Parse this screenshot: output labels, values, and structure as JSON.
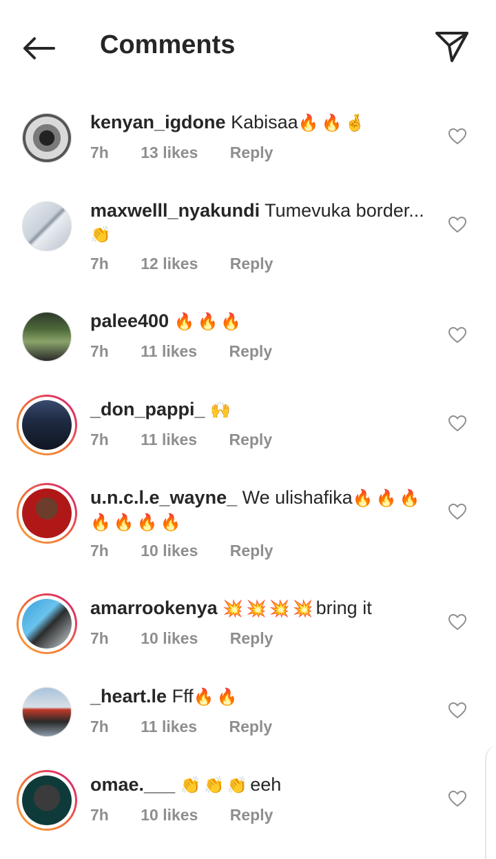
{
  "header": {
    "title": "Comments",
    "back_icon": "arrow-left-icon",
    "share_icon": "paper-plane-icon"
  },
  "colors": {
    "text": "#262626",
    "meta": "#8e8e8e",
    "story_ring_start": "#f9a33b",
    "story_ring_end": "#c8287a"
  },
  "comments": [
    {
      "username": "kenyan_igdone",
      "text": "Kabisaa",
      "emoji": "🔥🔥🤞",
      "time": "7h",
      "likes": "13 likes",
      "reply": "Reply",
      "avatar_ring": false
    },
    {
      "username": "maxwelll_nyakundi",
      "text": "Tumevuka border...",
      "emoji": "👏",
      "time": "7h",
      "likes": "12 likes",
      "reply": "Reply",
      "avatar_ring": false
    },
    {
      "username": "palee400",
      "text": "",
      "emoji": "🔥🔥🔥",
      "time": "7h",
      "likes": "11 likes",
      "reply": "Reply",
      "avatar_ring": false
    },
    {
      "username": "_don_pappi_",
      "text": "",
      "emoji": "🙌",
      "time": "7h",
      "likes": "11 likes",
      "reply": "Reply",
      "avatar_ring": true
    },
    {
      "username": "u.n.c.l.e_wayne_",
      "text": "We ulishafika",
      "emoji": "🔥🔥🔥🔥🔥🔥🔥",
      "time": "7h",
      "likes": "10 likes",
      "reply": "Reply",
      "avatar_ring": true
    },
    {
      "username": "amarrookenya",
      "text": "bring it",
      "emoji": "💥💥💥💥",
      "time": "7h",
      "likes": "10 likes",
      "reply": "Reply",
      "avatar_ring": true
    },
    {
      "username": "_heart.le",
      "text": "Fff",
      "emoji": "🔥🔥",
      "time": "7h",
      "likes": "11 likes",
      "reply": "Reply",
      "avatar_ring": false
    },
    {
      "username": "omae.___",
      "text": "eeh",
      "emoji": "👏👏👏",
      "time": "7h",
      "likes": "10 likes",
      "reply": "Reply",
      "avatar_ring": true
    }
  ]
}
